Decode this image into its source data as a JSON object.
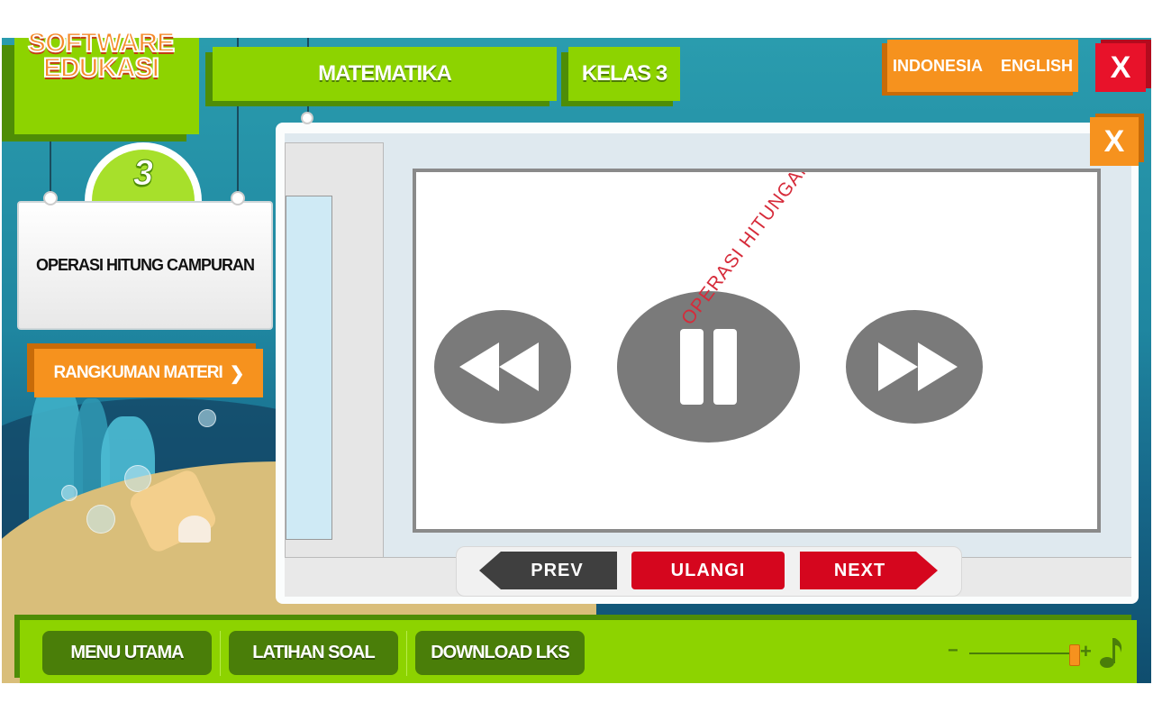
{
  "app": {
    "logo_text": "SOFTWARE EDUKASI",
    "subject_tab": "MATEMATIKA",
    "class_tab": "KELAS 3"
  },
  "language": {
    "indonesia": "INDONESIA",
    "english": "ENGLISH"
  },
  "window_controls": {
    "close": "X",
    "panel_close": "X"
  },
  "lesson": {
    "number": "3",
    "title": "OPERASI HITUNG CAMPURAN",
    "summary_button": "RANGKUMAN MATERI",
    "summary_arrow": "❯"
  },
  "player": {
    "watermark": "OPERASI HITUNGAN CAMPURAN",
    "rewind_icon": "rewind-icon",
    "pause_icon": "pause-icon",
    "forward_icon": "fast-forward-icon",
    "prev": "PREV",
    "replay": "ULANGI",
    "next": "NEXT"
  },
  "bottom_nav": {
    "main_menu": "MENU UTAMA",
    "exercise": "LATIHAN SOAL",
    "download": "DOWNLOAD LKS"
  },
  "volume": {
    "minus": "−",
    "plus": "+",
    "level": 0.95,
    "music_icon": "music-note-icon"
  },
  "colors": {
    "green": "#8dd300",
    "dark_green": "#4a7e09",
    "orange": "#f6921e",
    "red": "#e8122a",
    "screen_grey": "#7a7a7a"
  }
}
